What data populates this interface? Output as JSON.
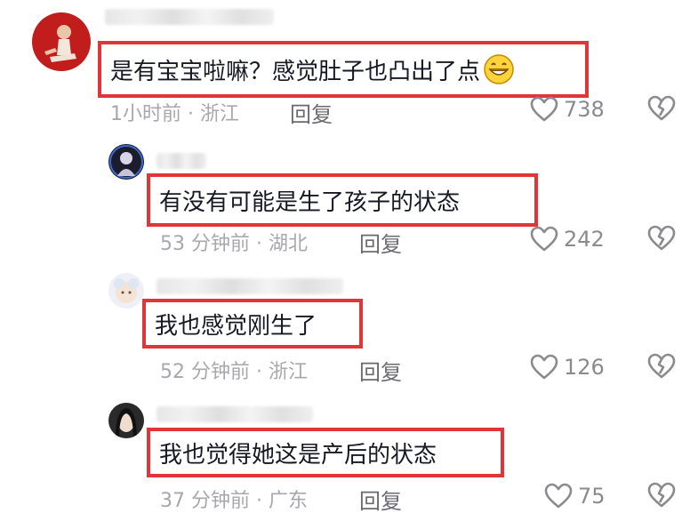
{
  "comments": [
    {
      "text": "是有宝宝啦嘛？感觉肚子也凸出了点",
      "emoji": "grinning-face-emoji",
      "meta": "1小时前 · 浙江",
      "reply": "回复",
      "likes": "738"
    },
    {
      "text": "有没有可能是生了孩子的状态",
      "meta": "53 分钟前 · 湖北",
      "reply": "回复",
      "likes": "242"
    },
    {
      "text": "我也感觉刚生了",
      "meta": "52 分钟前 · 浙江",
      "reply": "回复",
      "likes": "126"
    },
    {
      "text": "我也觉得她这是产后的状态",
      "meta": "37 分钟前 · 广东",
      "reply": "回复",
      "likes": "75"
    }
  ],
  "icons": {
    "like": "heart-outline-icon",
    "dislike": "broken-heart-icon"
  },
  "colors": {
    "highlight_border": "#e0363a",
    "meta_text": "#a8a8ac"
  }
}
